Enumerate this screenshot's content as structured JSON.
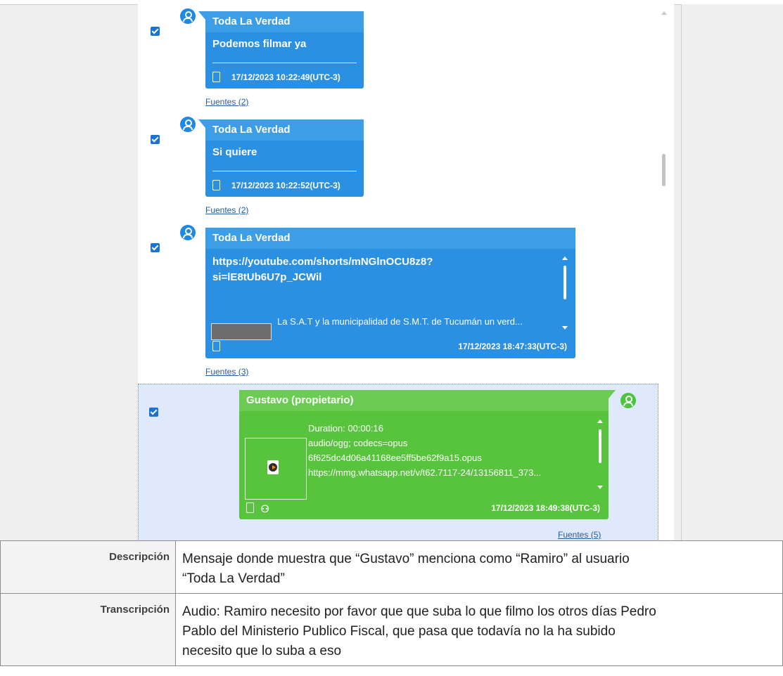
{
  "messages": [
    {
      "sender": "Toda La Verdad",
      "text": "Podemos filmar ya",
      "timestamp": "17/12/2023 10:22:49(UTC-3)",
      "sources": "Fuentes (2)"
    },
    {
      "sender": "Toda La Verdad",
      "text": "Si quiere",
      "timestamp": "17/12/2023 10:22:52(UTC-3)",
      "sources": "Fuentes (2)"
    },
    {
      "sender": "Toda La Verdad",
      "link_line1": "https://youtube.com/shorts/mNGlnOCU8z8?",
      "link_line2": "si=lE8tUb6U7p_JCWil",
      "preview_text": "La S.A.T y la municipalidad de S.M.T. de Tucumán un verd...",
      "timestamp": "17/12/2023 18:47:33(UTC-3)",
      "sources": "Fuentes (3)"
    },
    {
      "sender": "Gustavo (propietario)",
      "duration": "Duration: 00:00:16",
      "mime": "audio/ogg; codecs=opus",
      "filename": "6f625dc4d06a41168ee5ff5be62f9a15.opus",
      "url": "https://mmg.whatsapp.net/v/t62.7117-24/13156811_373...",
      "timestamp": "17/12/2023 18:49:38(UTC-3)",
      "sources": "Fuentes (5)"
    }
  ],
  "details": {
    "description_label": "Descripción",
    "description_line1": "Mensaje donde muestra que “Gustavo” menciona como “Ramiro” al usuario",
    "description_line2": "“Toda La Verdad”",
    "transcription_label": "Transcripción",
    "transcription_line1": "Audio: Ramiro necesito por favor que que suba lo que filmo los otros días Pedro",
    "transcription_line2": "Pablo del Ministerio Publico Fiscal, que pasa que todavía no la ha subido",
    "transcription_line3": "necesito que lo suba a eso"
  },
  "colors": {
    "incoming_bubble": "#2b8fe2",
    "outgoing_bubble": "#58c43e",
    "checkbox": "#1a73d1",
    "selected_row": "#dfe9fb"
  }
}
